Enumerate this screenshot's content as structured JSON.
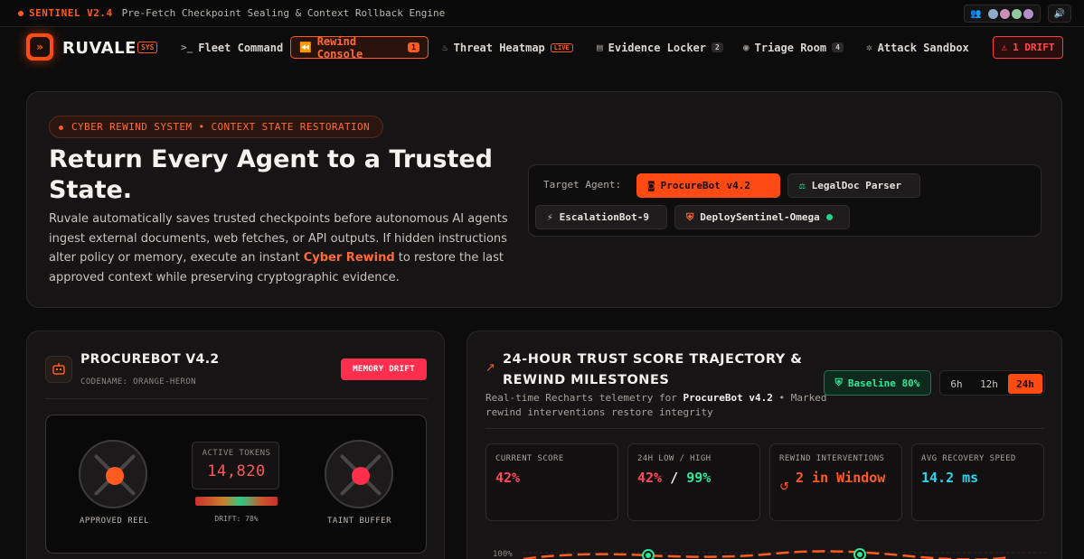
{
  "statusbar": {
    "brand": "SENTINEL V2.4",
    "subtitle": "Pre-Fetch Checkpoint Sealing & Context Rollback Engine"
  },
  "nav": {
    "app_name": "RUVALE",
    "sys_badge": "SYS",
    "items": [
      {
        "label": "Fleet Command",
        "icon": "terminal-icon"
      },
      {
        "label": "Rewind Console",
        "icon": "rewind-icon",
        "badge": "1"
      },
      {
        "label": "Threat Heatmap",
        "icon": "flame-icon",
        "badge": "LIVE"
      },
      {
        "label": "Evidence Locker",
        "icon": "file-check-icon",
        "badge": "2"
      },
      {
        "label": "Triage Room",
        "icon": "radio-icon",
        "badge": "4"
      },
      {
        "label": "Attack Sandbox",
        "icon": "bug-icon"
      }
    ],
    "drift_button": "1 DRIFT"
  },
  "hero": {
    "pill": "CYBER REWIND SYSTEM • CONTEXT STATE RESTORATION",
    "title": "Return Every Agent to a Trusted State.",
    "desc_before": "Ruvale automatically saves trusted checkpoints before autonomous AI agents ingest external documents, web fetches, or API outputs. If hidden instructions alter policy or memory, execute an instant ",
    "desc_highlight": "Cyber Rewind",
    "desc_after": " to restore the last approved context while preserving cryptographic evidence.",
    "target_label": "Target Agent:",
    "agents": [
      {
        "label": "ProcureBot v4.2",
        "selected": true
      },
      {
        "label": "LegalDoc Parser",
        "selected": false
      },
      {
        "label": "EscalationBot-9",
        "selected": false
      },
      {
        "label": "DeploySentinel-Omega",
        "selected": false
      }
    ]
  },
  "bot": {
    "title": "PROCUREBOT V4.2",
    "codename": "CODENAME: ORANGE-HERON",
    "status": "MEMORY DRIFT",
    "left_reel": "APPROVED REEL",
    "right_reel": "TAINT BUFFER",
    "tokens_label": "ACTIVE TOKENS",
    "tokens_value": "14,820",
    "drift_label": "DRIFT: 78%",
    "drift_value": 0.78
  },
  "trust": {
    "title": "24-HOUR TRUST SCORE TRAJECTORY & REWIND MILESTONES",
    "sub_before": "Real-time Recharts telemetry for ",
    "sub_bot": "ProcureBot v4.2",
    "sub_after": " • Marked rewind interventions restore integrity",
    "baseline": "Baseline 80%",
    "ranges": [
      "6h",
      "12h",
      "24h"
    ],
    "active_range": "24h",
    "stats": [
      {
        "label": "CURRENT SCORE",
        "value": "42%"
      },
      {
        "label": "24H LOW / HIGH",
        "low": "42%",
        "sep": "/",
        "high": "99%"
      },
      {
        "label": "REWIND INTERVENTIONS",
        "value": "2 in Window"
      },
      {
        "label": "AVG RECOVERY SPEED",
        "value": "14.2 ms"
      }
    ],
    "chart_ylabel": "100%"
  },
  "colors": {
    "accent": "#ff5a1f",
    "danger": "#ff2e4d",
    "success": "#2ee89a",
    "info": "#2ad5f0"
  }
}
